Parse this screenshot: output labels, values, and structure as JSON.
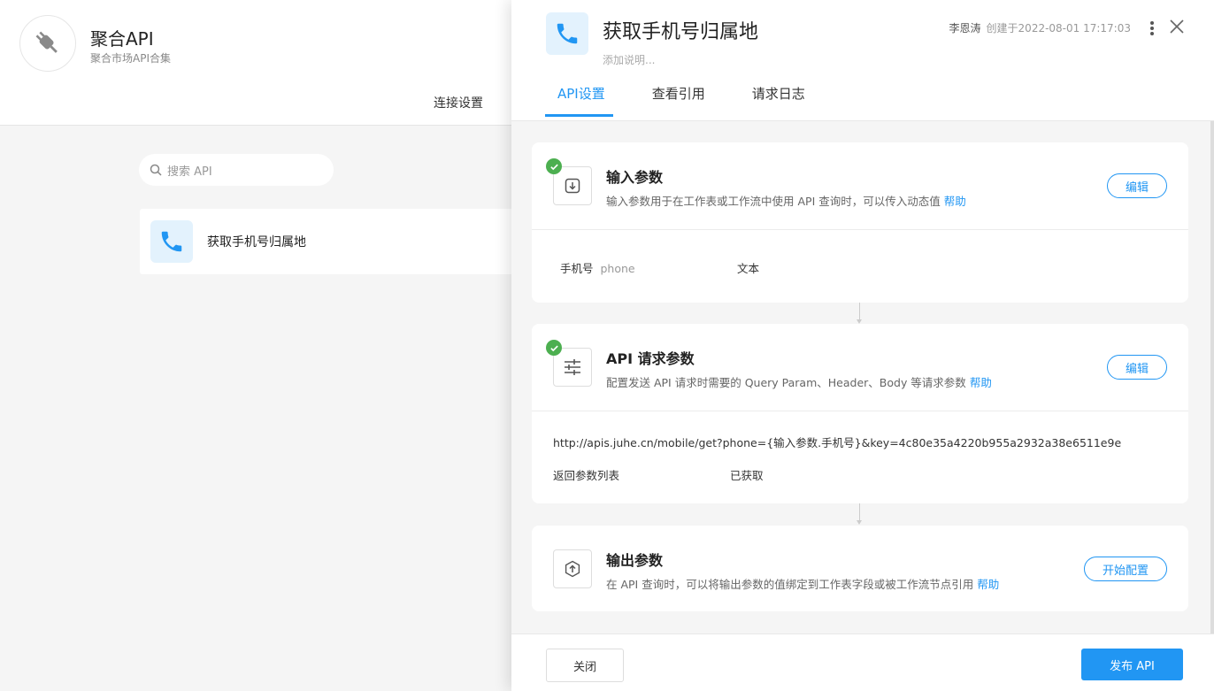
{
  "app": {
    "title": "聚合API",
    "subtitle": "聚合市场API合集",
    "tab_connection": "连接设置"
  },
  "search": {
    "placeholder": "搜索 API"
  },
  "api_list": [
    {
      "name": "获取手机号归属地",
      "icon": "phone-icon"
    }
  ],
  "drawer": {
    "title": "获取手机号归属地",
    "description_placeholder": "添加说明...",
    "author": "李恩涛",
    "created": "创建于2022-08-01 17:17:03",
    "tabs": [
      {
        "label": "API设置",
        "active": true
      },
      {
        "label": "查看引用",
        "active": false
      },
      {
        "label": "请求日志",
        "active": false
      }
    ],
    "input_params": {
      "title": "输入参数",
      "desc": "输入参数用于在工作表或工作流中使用 API 查询时，可以传入动态值",
      "help": "帮助",
      "edit": "编辑",
      "param_name": "手机号",
      "param_key": "phone",
      "param_type": "文本"
    },
    "request_params": {
      "title": "API 请求参数",
      "desc": "配置发送 API 请求时需要的 Query Param、Header、Body 等请求参数",
      "help": "帮助",
      "edit": "编辑",
      "url": "http://apis.juhe.cn/mobile/get?phone={输入参数.手机号}&key=4c80e35a4220b955a2932a38e6511e9e",
      "return_label": "返回参数列表",
      "return_status": "已获取"
    },
    "output_params": {
      "title": "输出参数",
      "desc": "在 API 查询时，可以将输出参数的值绑定到工作表字段或被工作流节点引用",
      "help": "帮助",
      "configure": "开始配置"
    },
    "footer": {
      "close": "关闭",
      "publish": "发布 API"
    }
  },
  "colors": {
    "accent": "#2196f3",
    "success": "#4caf50",
    "phone_tile_bg": "#e3f2fd"
  }
}
